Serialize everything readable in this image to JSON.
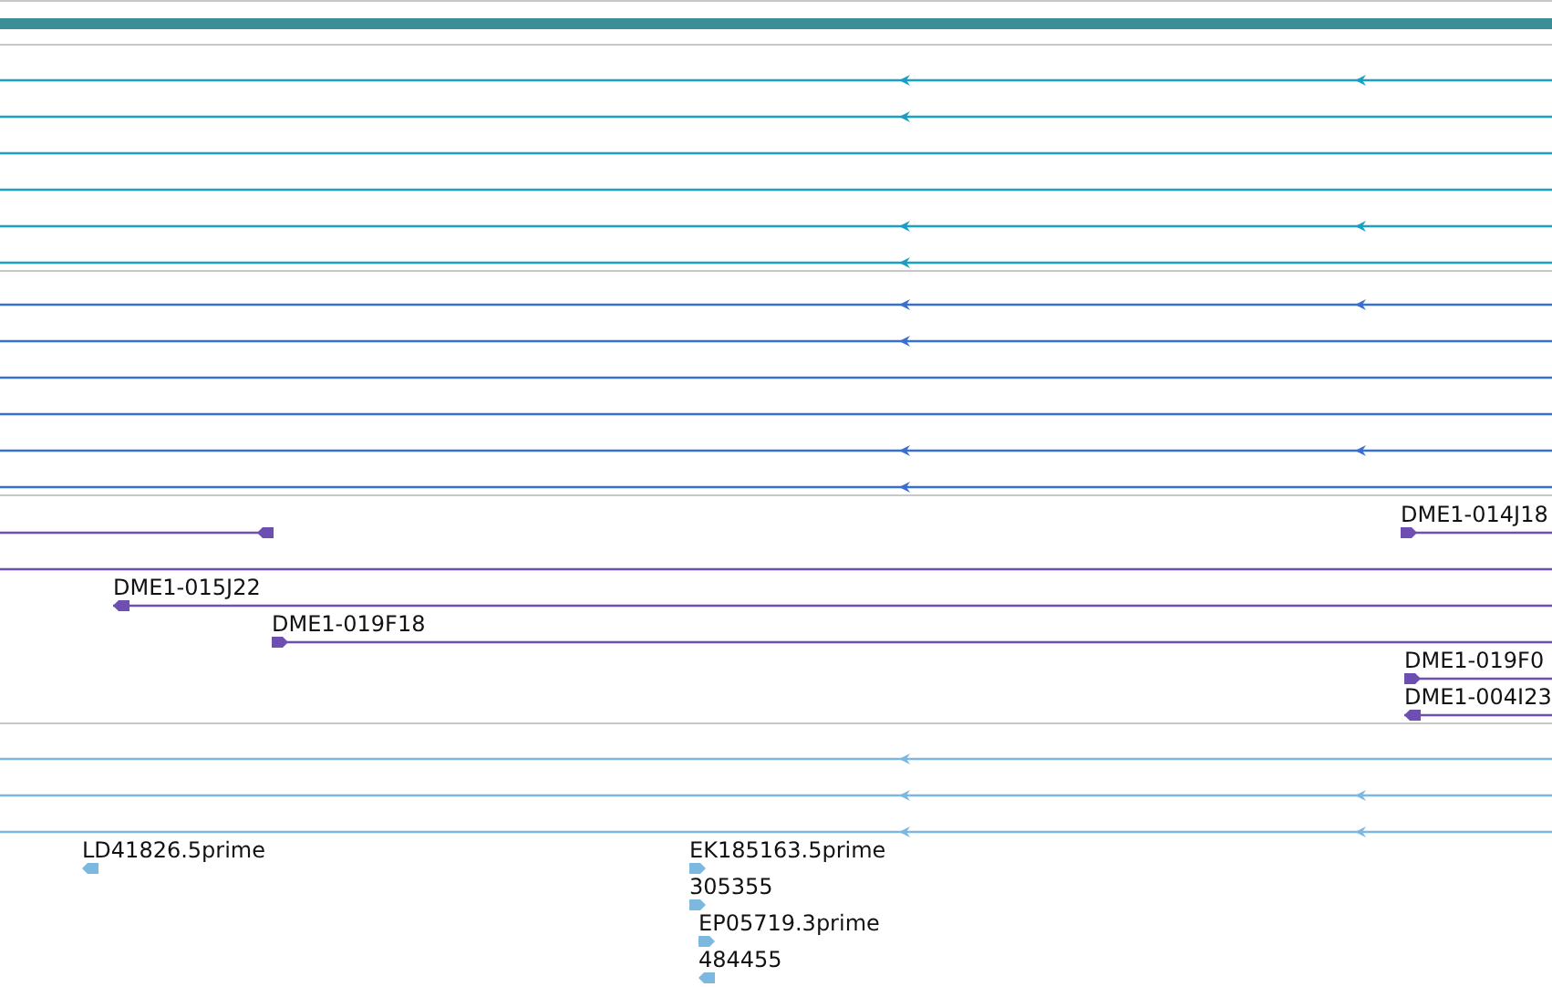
{
  "tracks": [
    {
      "kind": "bar",
      "color": "#3a8f96"
    },
    {
      "kind": "features",
      "color": "#1a9ec4",
      "features": [
        {
          "kind": "model",
          "forward": false
        },
        {
          "kind": "model",
          "forward": false
        },
        {
          "kind": "model"
        },
        {
          "kind": "model"
        },
        {
          "kind": "model",
          "forward": false
        },
        {
          "kind": "model",
          "forward": false
        }
      ]
    },
    {
      "kind": "features",
      "color": "#3a6fd2",
      "features": [
        {
          "kind": "model",
          "forward": false
        },
        {
          "kind": "model",
          "forward": false
        },
        {
          "kind": "model"
        },
        {
          "kind": "model"
        },
        {
          "kind": "model",
          "forward": false
        },
        {
          "kind": "model",
          "forward": false
        }
      ]
    },
    {
      "kind": "features",
      "color": "#6d4fb2",
      "features": [
        {
          "kind": "model",
          "forward": false
        },
        {
          "kind": "model",
          "forward": true,
          "label": "DME1-014J18"
        },
        {
          "kind": "model"
        },
        {
          "kind": "model",
          "forward": false,
          "label": "DME1-015J22"
        },
        {
          "kind": "model",
          "forward": true,
          "label": "DME1-019F18"
        },
        {
          "kind": "model",
          "forward": true,
          "label": "DME1-019F0"
        },
        {
          "kind": "model",
          "forward": false,
          "label": "DME1-004I23"
        }
      ]
    },
    {
      "kind": "features",
      "color": "#7db8e0",
      "features": [
        {
          "kind": "model",
          "forward": false
        },
        {
          "kind": "model",
          "forward": false
        },
        {
          "kind": "model",
          "forward": false
        },
        {
          "kind": "read",
          "forward": false,
          "label": "LD41826.5prime"
        },
        {
          "kind": "read",
          "forward": true,
          "label": "EK185163.5prime"
        },
        {
          "kind": "read",
          "forward": true,
          "label": "305355"
        },
        {
          "kind": "read",
          "forward": true,
          "label": "EP05719.3prime"
        },
        {
          "kind": "read",
          "forward": false,
          "label": "484455"
        }
      ]
    }
  ]
}
